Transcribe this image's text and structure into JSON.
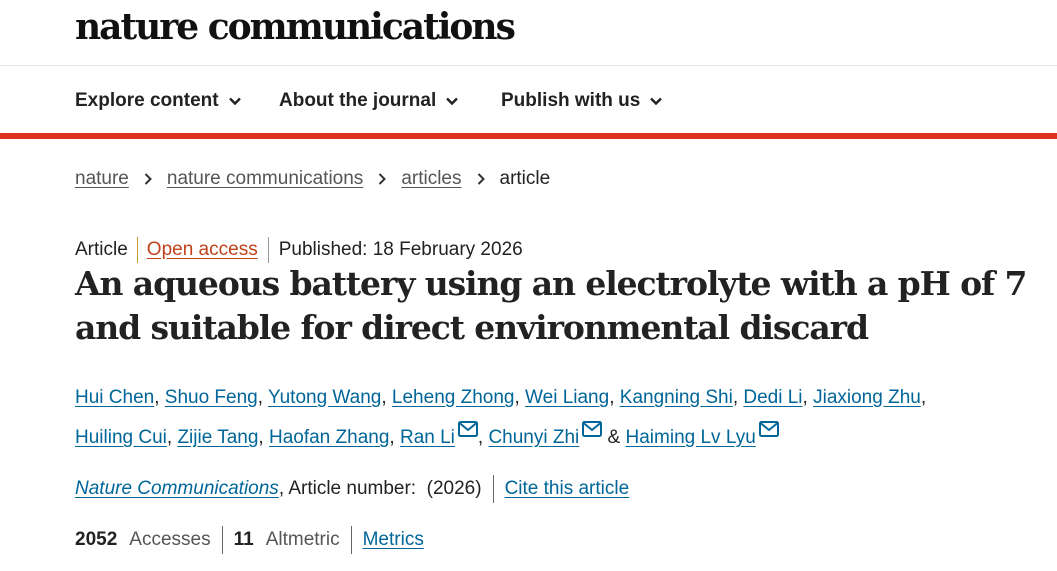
{
  "header": {
    "logo": "nature communications"
  },
  "nav": {
    "items": [
      {
        "label": "Explore content"
      },
      {
        "label": "About the journal"
      },
      {
        "label": "Publish with us"
      }
    ]
  },
  "breadcrumbs": {
    "items": [
      "nature",
      "nature communications",
      "articles"
    ],
    "current": "article"
  },
  "article": {
    "type": "Article",
    "access": "Open access",
    "published": "Published: 18 February 2026",
    "title": "An aqueous battery using an electrolyte with a pH of 7 and suitable for direct environmental discard",
    "authors": [
      "Hui Chen",
      "Shuo Feng",
      "Yutong Wang",
      "Leheng Zhong",
      "Wei Liang",
      "Kangning Shi",
      "Dedi Li",
      "Jiaxiong Zhu",
      "Huiling Cui",
      "Zijie Tang",
      "Haofan Zhang",
      "Ran Li",
      "Chunyi Zhi",
      "Haiming Lv Lyu"
    ],
    "journal": "Nature Communications",
    "article_number": ", Article number:  (2026)",
    "cite_label": "Cite this article",
    "accesses_count": "2052",
    "accesses_label": "Accesses",
    "altmetric_count": "11",
    "altmetric_label": "Altmetric",
    "metrics_label": "Metrics"
  },
  "colors": {
    "accent_bar": "#e0301e",
    "link": "#006699",
    "open_access": "#c0421a"
  },
  "icons": {
    "nav_chevron": "chevron-down-icon",
    "breadcrumb_sep": "chevron-right-icon",
    "author_contact": "envelope-icon"
  }
}
